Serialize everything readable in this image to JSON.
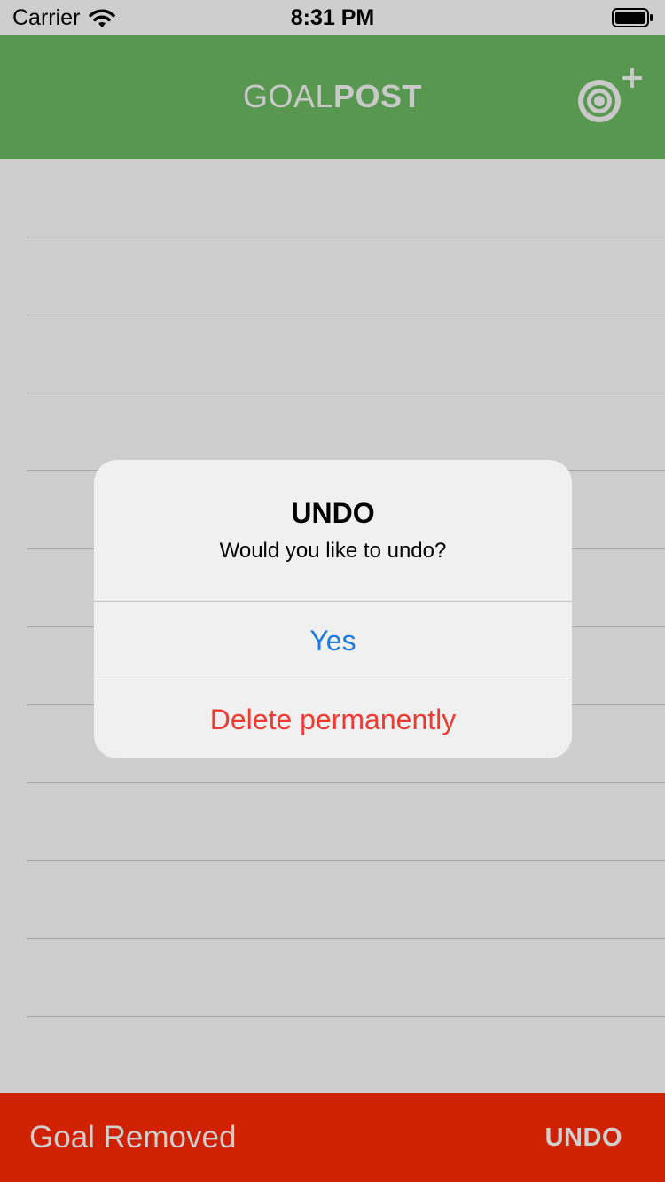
{
  "status_bar": {
    "carrier": "Carrier",
    "time": "8:31 PM",
    "icons": [
      "wifi-icon",
      "battery-icon"
    ]
  },
  "header": {
    "brand_light": "GOAL",
    "brand_bold": "POST",
    "add_goal_icon": "target-plus-icon",
    "background_color": "#58974f"
  },
  "goal_list": {
    "rows": [
      "",
      "",
      "",
      "",
      "",
      "",
      "",
      "",
      "",
      "",
      "",
      ""
    ]
  },
  "alert": {
    "title": "UNDO",
    "message": "Would you like to undo?",
    "yes_label": "Yes",
    "delete_label": "Delete permanently",
    "yes_color": "#1a7ae0",
    "delete_color": "#ef3a33"
  },
  "snackbar": {
    "message": "Goal Removed",
    "action_label": "UNDO",
    "background_color": "#d02200"
  }
}
